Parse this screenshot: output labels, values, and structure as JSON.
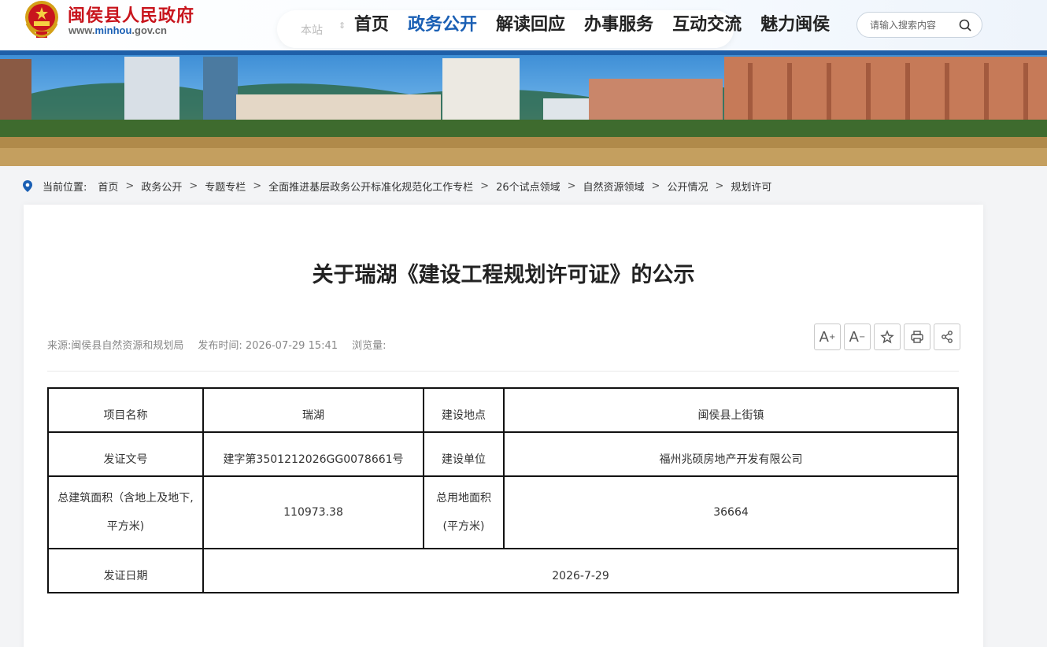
{
  "header": {
    "site_name": "闽侯县人民政府",
    "site_url_prefix": "www.",
    "site_url_main": "minhou",
    "site_url_suffix": ".gov.cn",
    "scope_label": "本站",
    "nav": [
      {
        "label": "首页",
        "active": false
      },
      {
        "label": "政务公开",
        "active": true
      },
      {
        "label": "解读回应",
        "active": false
      },
      {
        "label": "办事服务",
        "active": false
      },
      {
        "label": "互动交流",
        "active": false
      },
      {
        "label": "魅力闽侯",
        "active": false
      }
    ],
    "search_placeholder": "请输入搜索内容"
  },
  "breadcrumb": {
    "label": "当前位置:",
    "items": [
      "首页",
      "政务公开",
      "专题专栏",
      "全面推进基层政务公开标准化规范化工作专栏",
      "26个试点领域",
      "自然资源领域",
      "公开情况",
      "规划许可"
    ],
    "separator": ">"
  },
  "article": {
    "title": "关于瑞湖《建设工程规划许可证》的公示",
    "source": "来源:闽侯县自然资源和规划局",
    "publish_time": "发布时间: 2026-07-29 15:41",
    "views": "浏览量:",
    "tools": [
      "A+",
      "A-",
      "favorite",
      "print",
      "share"
    ]
  },
  "table": {
    "project_name_label": "项目名称",
    "project_name": "瑞湖",
    "location_label": "建设地点",
    "location": "闽侯县上街镇",
    "permit_no_label": "发证文号",
    "permit_no": "建字第3501212026GG0078661号",
    "builder_label": "建设单位",
    "builder": "福州兆硕房地产开发有限公司",
    "total_area_label_1": "总建筑面积（含地上及地下,",
    "total_area_label_2": "平方米)",
    "total_area": "110973.38",
    "land_area_label_1": "总用地面积",
    "land_area_label_2": "(平方米)",
    "land_area": "36664",
    "issue_date_label": "发证日期",
    "issue_date": "2026-7-29"
  },
  "colors": {
    "brand_red": "#c8151d",
    "nav_active": "#1a5fb4",
    "banner_bar": "#1f5fa8"
  }
}
